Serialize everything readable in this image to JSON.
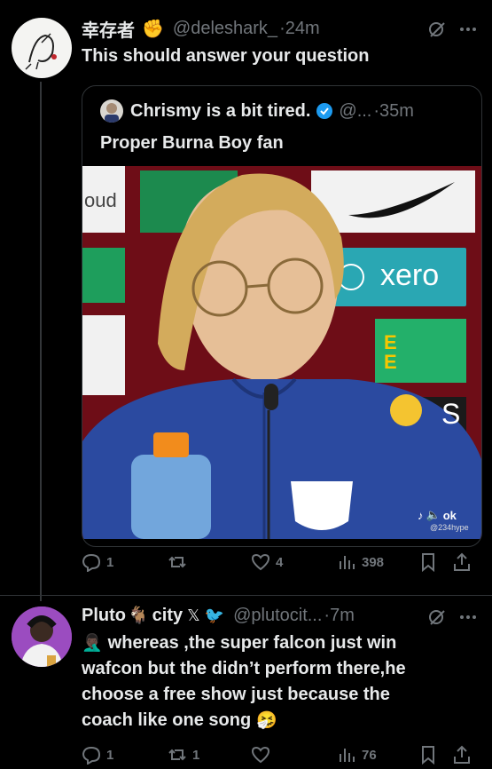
{
  "tweet1": {
    "display_name": "幸存者",
    "emoji": "✊",
    "handle": "@deleshark_",
    "time": "·24m",
    "text": "This should answer your question",
    "quote": {
      "display_name": "Chrismy is a bit tired.",
      "handle": "@...",
      "time": "·35m",
      "text": "Proper Burna Boy fan",
      "video": {
        "sponsor_text": "xero",
        "backdrop_text": "oud",
        "ee_letters": "E E",
        "s_letter": "S",
        "tiktok_label": "ok",
        "tiktok_handle": "@234hype"
      }
    },
    "actions": {
      "replies": "1",
      "reposts": "",
      "likes": "4",
      "views": "398"
    }
  },
  "tweet2": {
    "display_name": "Pluto",
    "name_emoji": "🐐",
    "name_suffix": "city",
    "x_mark": "𝕏",
    "bird_emoji": "🐦",
    "handle": "@plutocit...",
    "time": "·7m",
    "lead_emoji": "🤦🏿‍♂️",
    "lines": [
      "whereas ,the super falcon just win",
      "wafcon but the didn’t perform there,he",
      "choose a free show just because the",
      "coach like one song"
    ],
    "end_emoji": "🤧",
    "actions": {
      "replies": "1",
      "reposts": "1",
      "likes": "",
      "views": "76"
    }
  },
  "colors": {
    "background": "#000000",
    "text": "#e7e9ea",
    "secondary": "#71767b",
    "border": "#2f3336",
    "verified": "#1d9bf0"
  }
}
